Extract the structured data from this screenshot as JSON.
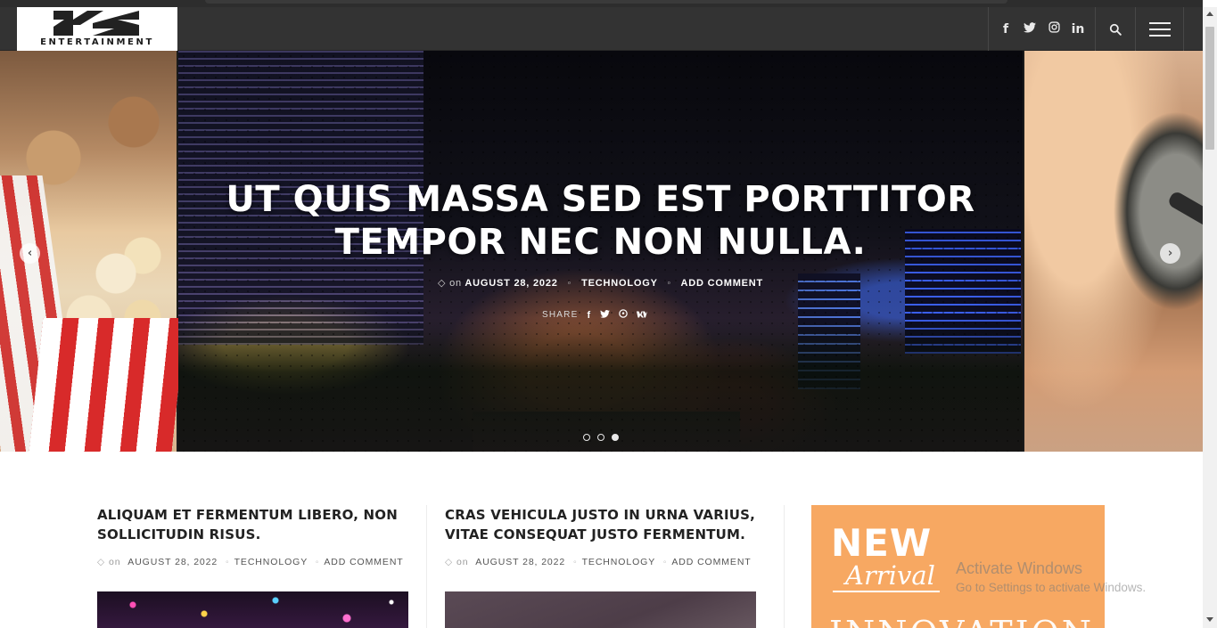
{
  "logo": {
    "text": "ENTERTAINMENT"
  },
  "header": {
    "social": [
      {
        "name": "facebook-icon",
        "glyph": "f"
      },
      {
        "name": "twitter-icon",
        "glyph": "t"
      },
      {
        "name": "instagram-icon",
        "glyph": "◎"
      },
      {
        "name": "linkedin-icon",
        "glyph": "in"
      }
    ]
  },
  "slider": {
    "title_line1": "UT QUIS MASSA SED EST PORTTITOR",
    "title_line2": "TEMPOR NEC NON NULLA.",
    "meta": {
      "on": "on",
      "date": "AUGUST 28, 2022",
      "category": "TECHNOLOGY",
      "comment": "ADD COMMENT"
    },
    "share": {
      "label": "SHARE"
    },
    "dots": 3,
    "active_dot": 3
  },
  "posts": [
    {
      "title_line1": "ALIQUAM ET FERMENTUM LIBERO, NON",
      "title_line2": "SOLLICITUDIN RISUS.",
      "on": "on",
      "date": "AUGUST 28, 2022",
      "category": "TECHNOLOGY",
      "comment": "ADD COMMENT"
    },
    {
      "title_line1": "CRAS VEHICULA JUSTO IN URNA VARIUS,",
      "title_line2": "VITAE CONSEQUAT JUSTO FERMENTUM.",
      "on": "on",
      "date": "AUGUST 28, 2022",
      "category": "TECHNOLOGY",
      "comment": "ADD COMMENT"
    }
  ],
  "ad": {
    "new": "NEW",
    "arrival": "Arrival",
    "innovation": "INNOVATION",
    "background_color": "#f7a862"
  },
  "watermark": {
    "line1": "Activate Windows",
    "line2": "Go to Settings to activate Windows."
  }
}
